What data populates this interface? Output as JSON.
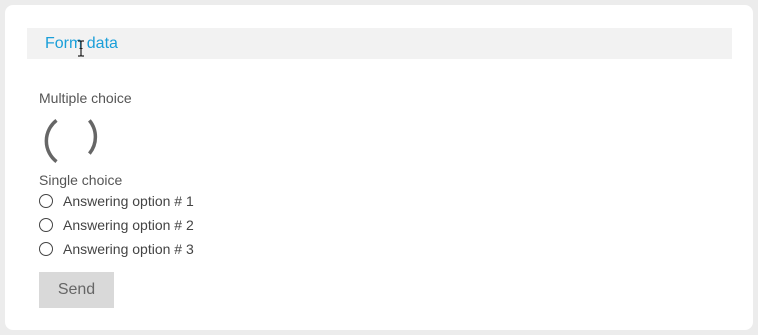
{
  "header": {
    "title_link": "Form data",
    "cursor_icon": "text-cursor-icon"
  },
  "multiple_choice": {
    "label": "Multiple choice",
    "loading_icon": "loading-spinner-icon"
  },
  "single_choice": {
    "label": "Single choice",
    "options": [
      {
        "label": "Answering option # 1",
        "selected": false
      },
      {
        "label": "Answering option # 2",
        "selected": false
      },
      {
        "label": "Answering option # 3",
        "selected": false
      }
    ]
  },
  "actions": {
    "send_label": "Send"
  },
  "colors": {
    "link": "#1a9fd9",
    "header_bg": "#f2f2f2",
    "button_bg": "#d9d9d9",
    "page_bg": "#ececec",
    "spinner": "#666666"
  }
}
